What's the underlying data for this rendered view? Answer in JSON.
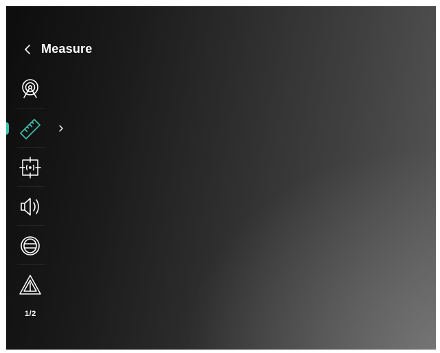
{
  "header": {
    "title": "Measure"
  },
  "menu": {
    "items": [
      {
        "icon": "radar-signal-icon",
        "selected": false
      },
      {
        "icon": "ruler-icon",
        "selected": true,
        "has_submenu": true
      },
      {
        "icon": "center-target-icon",
        "selected": false
      },
      {
        "icon": "speaker-icon",
        "selected": false
      },
      {
        "icon": "globe-icon",
        "selected": false
      },
      {
        "icon": "warning-triangle-icon",
        "selected": false
      }
    ]
  },
  "pagination": {
    "label": "1/2"
  },
  "colors": {
    "accent": "#3fc1b0",
    "icon": "#ffffff",
    "text": "#ffffff"
  }
}
